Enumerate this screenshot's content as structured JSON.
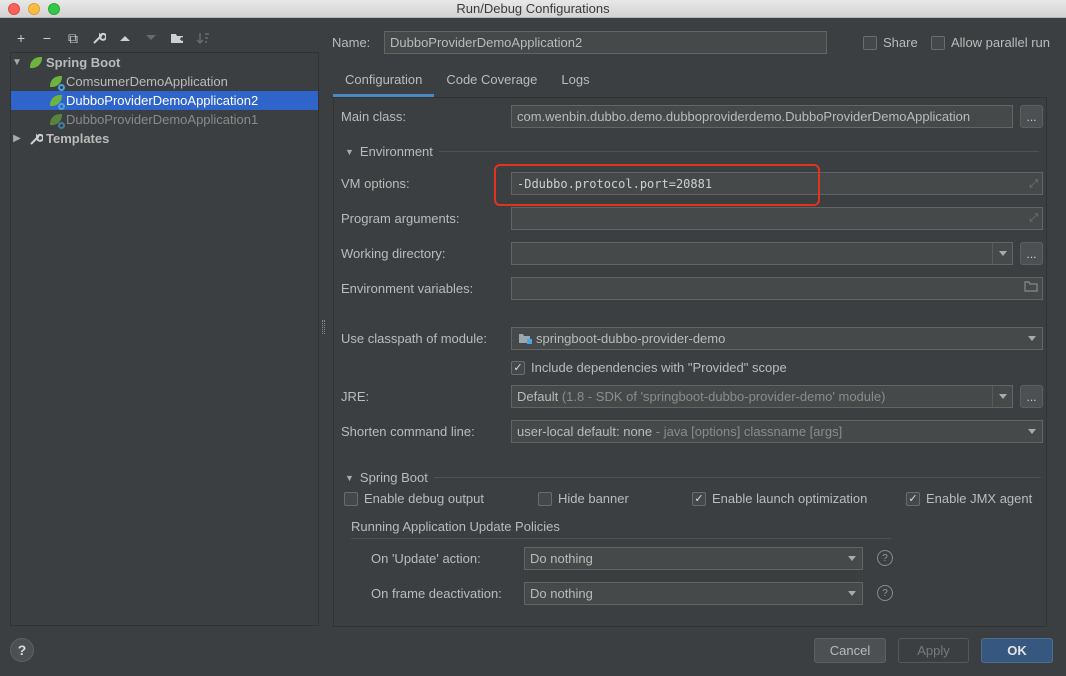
{
  "window": {
    "title": "Run/Debug Configurations"
  },
  "toolbar": {
    "add": "+",
    "remove": "−",
    "copy": "⧉",
    "edit": "🔧",
    "up": "▲",
    "down": "▼",
    "folder": "▰",
    "sort": "↓"
  },
  "tree": {
    "spring_boot": "Spring Boot",
    "items": [
      {
        "label": "ComsumerDemoApplication"
      },
      {
        "label": "DubboProviderDemoApplication2"
      },
      {
        "label": "DubboProviderDemoApplication1"
      }
    ],
    "templates": "Templates"
  },
  "header": {
    "name_label": "Name:",
    "name_value": "DubboProviderDemoApplication2",
    "share_label": "Share",
    "share_checked": false,
    "parallel_label": "Allow parallel run",
    "parallel_checked": false
  },
  "tabs": [
    {
      "label": "Configuration",
      "active": true
    },
    {
      "label": "Code Coverage",
      "active": false
    },
    {
      "label": "Logs",
      "active": false
    }
  ],
  "config": {
    "main_class_label": "Main class:",
    "main_class_value": "com.wenbin.dubbo.demo.dubboproviderdemo.DubboProviderDemoApplication",
    "environment_section": "Environment",
    "vm_options_label": "VM options:",
    "vm_options_value": "-Ddubbo.protocol.port=20881",
    "program_args_label": "Program arguments:",
    "program_args_value": "",
    "working_dir_label": "Working directory:",
    "working_dir_value": "",
    "env_vars_label": "Environment variables:",
    "env_vars_value": "",
    "classpath_label": "Use classpath of module:",
    "classpath_value": "springboot-dubbo-provider-demo",
    "include_deps_label": "Include dependencies with \"Provided\" scope",
    "include_deps_checked": true,
    "jre_label": "JRE:",
    "jre_value_main": "Default",
    "jre_value_detail": "(1.8 - SDK of 'springboot-dubbo-provider-demo' module)",
    "shorten_label": "Shorten command line:",
    "shorten_value_main": "user-local default: none",
    "shorten_value_detail": " - java [options] classname [args]",
    "spring_boot_section": "Spring Boot",
    "debug_output_label": "Enable debug output",
    "debug_output_checked": false,
    "hide_banner_label": "Hide banner",
    "hide_banner_checked": false,
    "launch_opt_label": "Enable launch optimization",
    "launch_opt_checked": true,
    "jmx_label": "Enable JMX agent",
    "jmx_checked": true,
    "update_policies_section": "Running Application Update Policies",
    "on_update_label": "On 'Update' action:",
    "on_update_value": "Do nothing",
    "on_frame_label": "On frame deactivation:",
    "on_frame_value": "Do nothing",
    "dots": "...",
    "help_glyph": "?",
    "check_glyph": "✓"
  },
  "buttons": {
    "help": "?",
    "cancel": "Cancel",
    "apply": "Apply",
    "ok": "OK"
  },
  "colors": {
    "background": "#3c3f41",
    "selection": "#2f65ca",
    "highlight": "#e0341f",
    "ok_button": "#365880",
    "spring_green": "#6db33f"
  }
}
